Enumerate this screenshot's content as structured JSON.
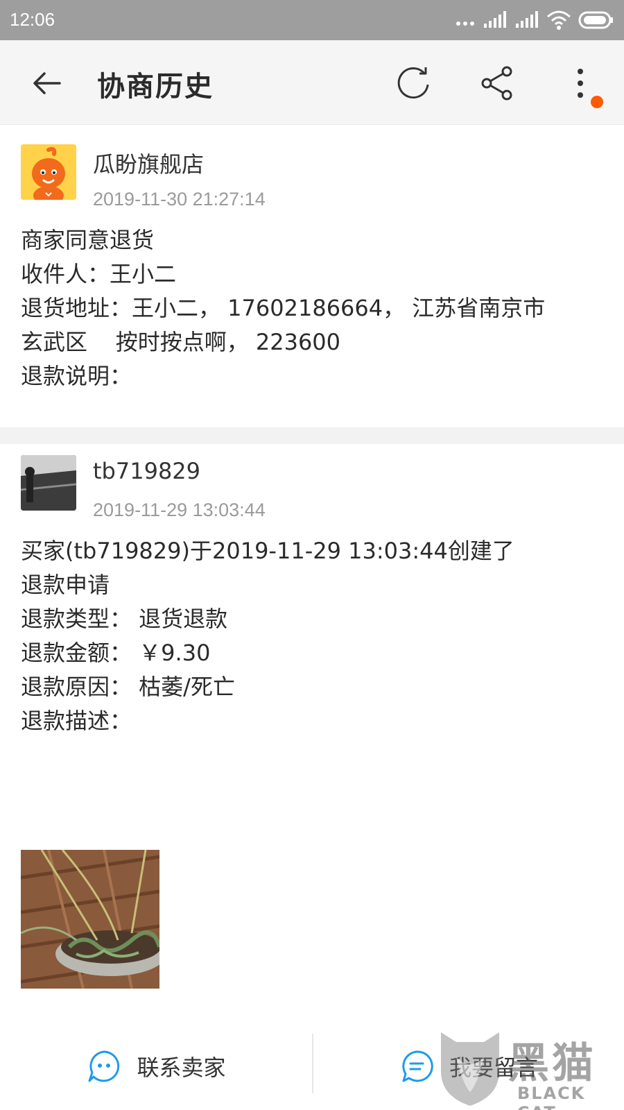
{
  "status_bar": {
    "time": "12:06"
  },
  "appbar": {
    "title": "协商历史"
  },
  "entries": [
    {
      "name": "瓜盼旗舰店",
      "time": "2019-11-30 21:27:14",
      "lines": [
        "商家同意退货",
        "收件人：王小二",
        "退货地址：王小二， 17602186664， 江苏省南京市",
        "玄武区    按时按点啊， 223600",
        "退款说明："
      ]
    },
    {
      "name": "tb719829",
      "time": "2019-11-29 13:03:44",
      "lines": [
        "买家(tb719829)于2019-11-29 13:03:44创建了",
        "退款申请",
        "退款类型： 退货退款",
        "退款金额： ￥9.30",
        "退款原因： 枯萎/死亡",
        "退款描述："
      ]
    }
  ],
  "bottom_bar": {
    "contact_seller": "联系卖家",
    "leave_message": "我要留言"
  },
  "watermark": {
    "text": "黑猫",
    "sub": "BLACK CAT"
  },
  "colors": {
    "accent": "#ff5a00",
    "icon_blue": "#1e9be8"
  }
}
